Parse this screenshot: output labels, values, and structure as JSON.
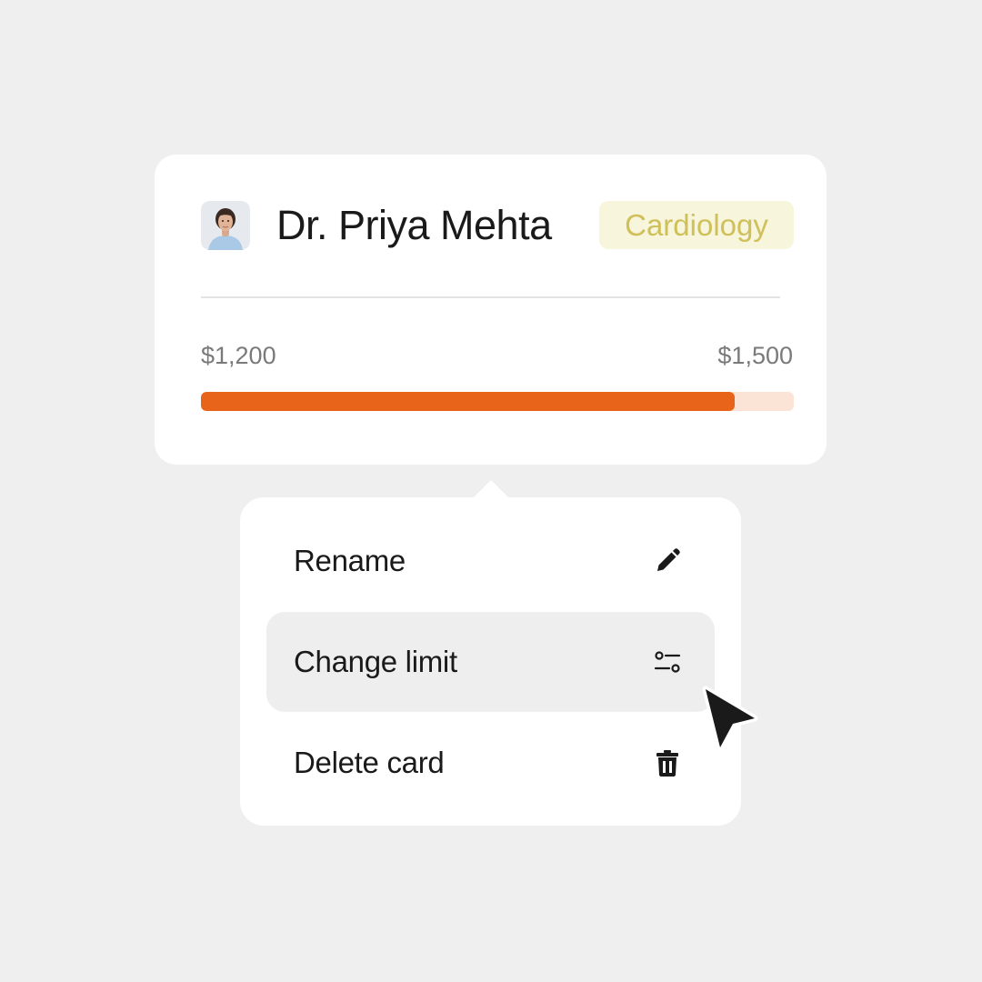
{
  "card": {
    "name": "Dr. Priya Mehta",
    "badge": "Cardiology",
    "spent": "$1,200",
    "limit": "$1,500",
    "progress_fraction": 0.9,
    "accent_color": "#e8641a",
    "track_color": "#fbe3d6",
    "badge_bg_color": "#f7f5dc",
    "badge_text_color": "#cfc05a"
  },
  "menu": {
    "items": [
      {
        "label": "Rename",
        "icon": "pencil-icon",
        "active": false
      },
      {
        "label": "Change limit",
        "icon": "sliders-icon",
        "active": true
      },
      {
        "label": "Delete card",
        "icon": "trash-icon",
        "active": false
      }
    ]
  }
}
